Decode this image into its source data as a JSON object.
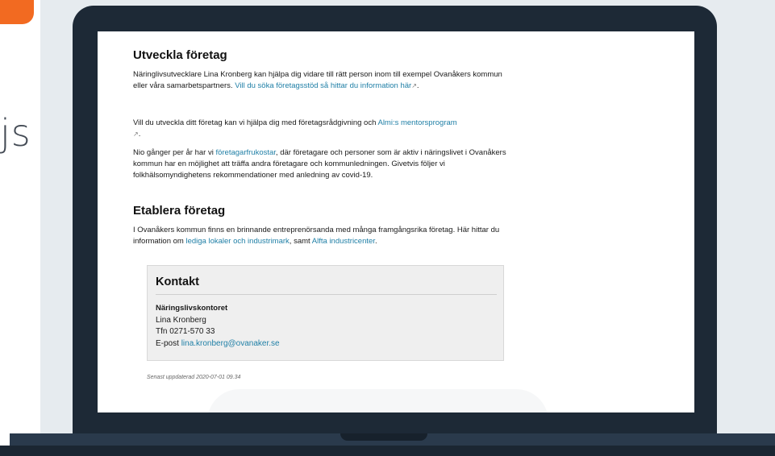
{
  "side": {
    "partial_text": "js"
  },
  "page": {
    "section1": {
      "heading": "Utveckla företag",
      "p1_text": "Näringlivsutvecklare Lina Kronberg kan hjälpa dig vidare till rätt person inom till exempel Ovanåkers kommun eller våra samarbetspartners. ",
      "p1_link": "Vill du söka företagsstöd så hittar du information här",
      "p1_end": ".",
      "p2_text": "Vill du utveckla ditt företag kan vi hjälpa dig med företagsrådgivning och ",
      "p2_link": "Almi:s mentorsprogram",
      "p2_end": ".",
      "p3_start": "Nio gånger per år har vi ",
      "p3_link": "företagarfrukostar",
      "p3_rest": ", där företagare och personer som är aktiv i näringslivet i Ovanåkers kommun har en möjlighet att träffa andra företagare och kommunledningen. Givetvis följer vi folkhälsomyndighetens rekommendationer med anledning av covid-19."
    },
    "section2": {
      "heading": "Etablera företag",
      "p_text": "I Ovanåkers kommun finns en brinnande entreprenörsanda med många framgångsrika företag. Här hittar du information om ",
      "link1": "lediga lokaler och industrimark",
      "mid": ", samt ",
      "link2": "Alfta industricenter",
      "end": "."
    },
    "contact": {
      "heading": "Kontakt",
      "org": "Näringslivskontoret",
      "name": "Lina Kronberg",
      "phone": "Tfn 0271-570 33",
      "email_label": "E-post ",
      "email": "lina.kronberg@ovanaker.se"
    },
    "updated": "Senast uppdaterad 2020-07-01 09.34"
  },
  "icons": {
    "external_link": "external-link-icon"
  },
  "colors": {
    "link": "#1f7fa6",
    "laptop": "#1d2936",
    "accent": "#f26a21"
  }
}
